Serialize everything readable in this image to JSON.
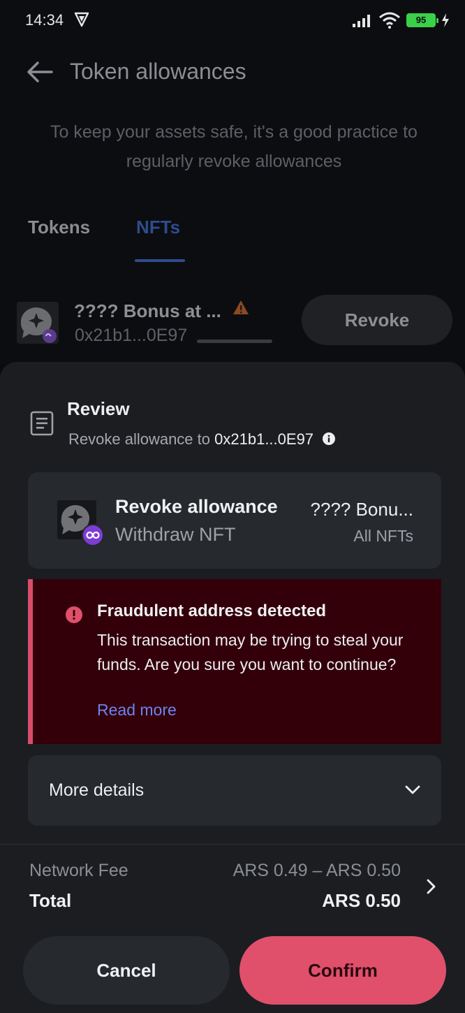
{
  "status_bar": {
    "time": "14:34",
    "battery": "95"
  },
  "header": {
    "title": "Token allowances",
    "subtitle": "To keep your assets safe, it's a good practice to regularly revoke allowances"
  },
  "tabs": [
    {
      "label": "Tokens",
      "active": false
    },
    {
      "label": "NFTs",
      "active": true
    }
  ],
  "nft_item": {
    "name": "???? Bonus at ...",
    "address": "0x21b1...0E97",
    "revoke_label": "Revoke"
  },
  "review": {
    "title": "Review",
    "subtitle_prefix": "Revoke allowance to",
    "address": "0x21b1...0E97"
  },
  "transaction": {
    "title": "Revoke allowance",
    "subtitle": "Withdraw NFT",
    "asset_name": "???? Bonu...",
    "asset_scope": "All NFTs"
  },
  "alert": {
    "title": "Fraudulent address detected",
    "body": "This transaction may be trying to steal your funds. Are you sure you want to continue?",
    "link": "Read more"
  },
  "more_details": {
    "label": "More details"
  },
  "fee": {
    "network_fee_label": "Network Fee",
    "network_fee_value": "ARS 0.49 – ARS 0.50",
    "total_label": "Total",
    "total_value": "ARS 0.50"
  },
  "actions": {
    "cancel": "Cancel",
    "confirm": "Confirm"
  },
  "colors": {
    "confirm": "#e0506b",
    "alert_bg": "#33000a",
    "alert_border": "#d94d6a",
    "link": "#6b84f0",
    "tab_active": "#2e4c8f"
  }
}
